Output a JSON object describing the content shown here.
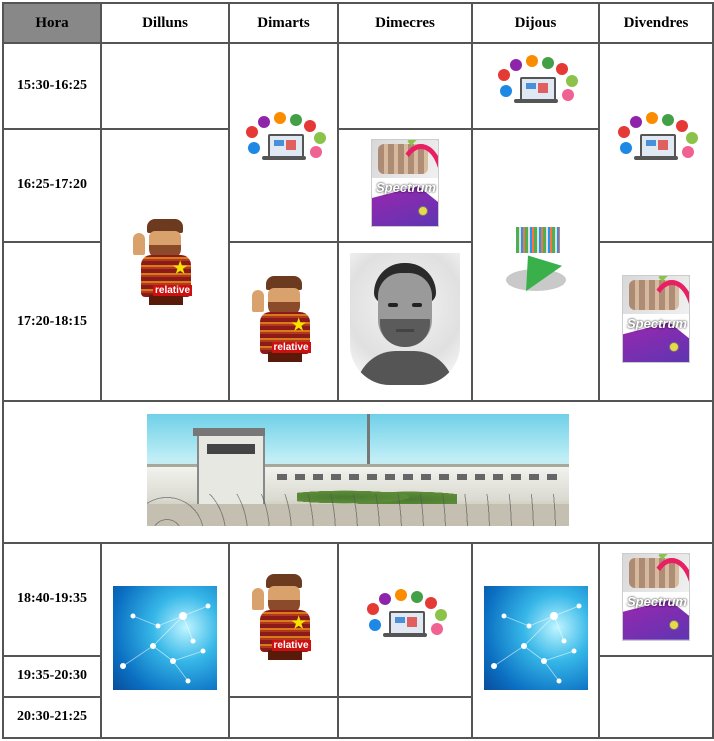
{
  "header": {
    "hora": "Hora",
    "days": [
      "Dilluns",
      "Dimarts",
      "Dimecres",
      "Dijous",
      "Divendres"
    ]
  },
  "times": {
    "t1": "15:30-16:25",
    "t2": "16:25-17:20",
    "t3": "17:20-18:15",
    "t4": "18:40-19:35",
    "t5": "19:35-20:30",
    "t6": "20:30-21:25"
  },
  "book": {
    "title": "Spectrum"
  },
  "cop": {
    "word": "relative"
  },
  "colors": {
    "header_bg": "#888888",
    "border": "#555555"
  }
}
